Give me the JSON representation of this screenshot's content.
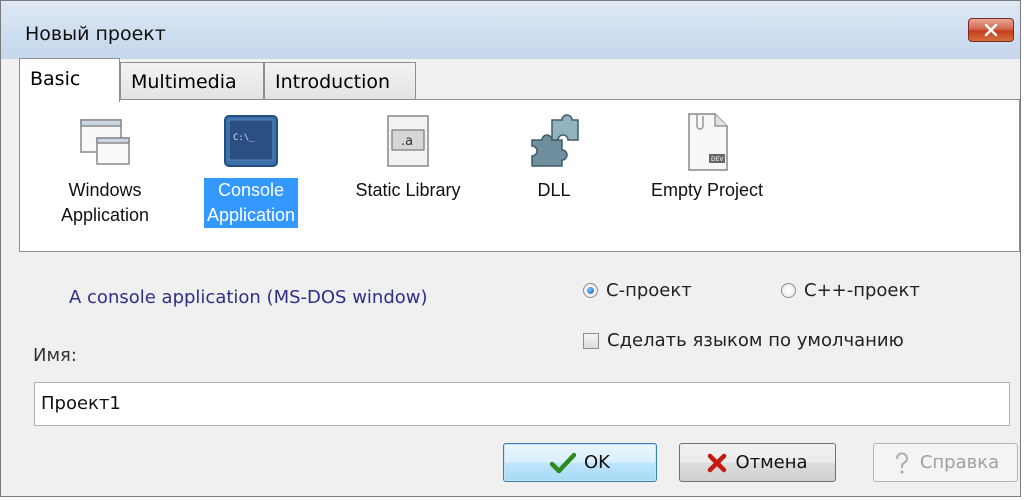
{
  "window": {
    "title": "Новый проект"
  },
  "tabs": [
    {
      "label": "Basic",
      "active": true
    },
    {
      "label": "Multimedia",
      "active": false
    },
    {
      "label": "Introduction",
      "active": false
    }
  ],
  "projects": [
    {
      "line1": "Windows",
      "line2": "Application",
      "icon": "windows-app-icon",
      "selected": false
    },
    {
      "line1": "Console",
      "line2": "Application",
      "icon": "console-app-icon",
      "selected": true
    },
    {
      "line1": "Static Library",
      "line2": "",
      "icon": "static-library-icon",
      "selected": false
    },
    {
      "line1": "DLL",
      "line2": "",
      "icon": "dll-icon",
      "selected": false
    },
    {
      "line1": "Empty Project",
      "line2": "",
      "icon": "empty-project-icon",
      "selected": false
    }
  ],
  "description": "A console application (MS-DOS window)",
  "language": {
    "c_label": "C-проект",
    "cpp_label": "C++-проект",
    "selected": "C-проект",
    "default_label": "Сделать языком по умолчанию",
    "default_checked": false
  },
  "name": {
    "label": "Имя:",
    "value": "Проект1"
  },
  "buttons": {
    "ok": "OK",
    "cancel": "Отмена",
    "help": "Справка"
  },
  "colors": {
    "selection": "#3399ff",
    "description_text": "#2e2f86"
  }
}
